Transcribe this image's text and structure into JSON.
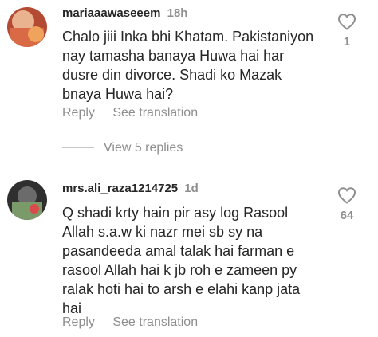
{
  "comments": [
    {
      "username": "mariaaawaseeem",
      "time": "18h",
      "text": "Chalo jiii Inka bhi Khatam. Pakistaniyon nay tamasha banaya Huwa hai har dusre din divorce. Shadi ko Mazak bnaya Huwa hai?",
      "likes": "1",
      "reply_label": "Reply",
      "translate_label": "See translation"
    },
    {
      "username": "mrs.ali_raza1214725",
      "time": "1d",
      "text": "Q shadi krty hain pir asy log Rasool Allah s.a.w ki nazr mei sb sy na pasandeeda amal talak hai farman e rasool Allah hai k jb roh e zameen py ralak hoti hai to arsh e elahi kanp jata hai",
      "likes": "64",
      "reply_label": "Reply",
      "translate_label": "See translation"
    }
  ],
  "view_replies_label": "View 5 replies",
  "colors": {
    "text": "#262626",
    "secondary": "#8e8e8e",
    "avatar1": "#c9573e",
    "avatar2": "#3a3a3a"
  },
  "icons": [
    "heart-outline-icon"
  ]
}
